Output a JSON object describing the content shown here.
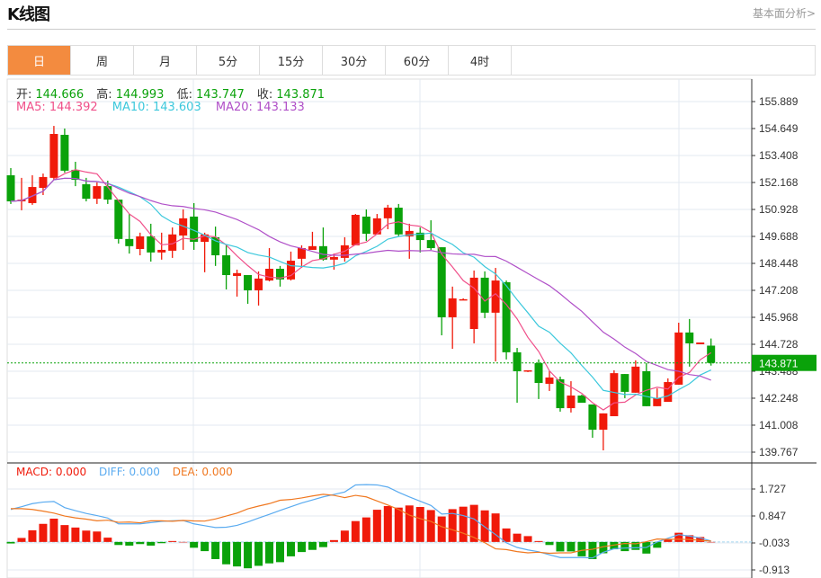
{
  "header": {
    "title": "K线图",
    "link": "基本面分析>"
  },
  "tabs": [
    "日",
    "周",
    "月",
    "5分",
    "15分",
    "30分",
    "60分",
    "4时"
  ],
  "active_tab": 0,
  "ohlc_info": {
    "open_label": "开:",
    "open": "144.666",
    "high_label": "高:",
    "high": "144.993",
    "low_label": "低:",
    "low": "143.747",
    "close_label": "收:",
    "close": "143.871"
  },
  "ma_info": {
    "ma5": "MA5: 144.392",
    "ma10": "MA10: 143.603",
    "ma20": "MA20: 143.133"
  },
  "macd_info": {
    "macd": "MACD: 0.000",
    "diff": "DIFF: 0.000",
    "dea": "DEA: 0.000"
  },
  "current_price": "143.871",
  "colors": {
    "up": "#f01a0a",
    "down": "#0aa20a",
    "ma5": "#f0508a",
    "ma10": "#3cc8dc",
    "ma20": "#b050c8",
    "diff": "#5aabf0",
    "dea": "#f07820"
  },
  "chart_data": {
    "type": "candlestick",
    "price_axis": {
      "ticks": [
        "155.889",
        "154.649",
        "153.408",
        "152.168",
        "150.928",
        "149.688",
        "148.448",
        "147.208",
        "145.968",
        "144.728",
        "143.488",
        "142.248",
        "141.008",
        "139.767"
      ],
      "range": [
        139.767,
        155.889
      ]
    },
    "macd_axis": {
      "ticks": [
        "1.727",
        "0.847",
        "-0.033",
        "-0.913"
      ],
      "range": [
        -0.913,
        1.727
      ]
    },
    "ohlc": [
      [
        152.5,
        152.83,
        151.18,
        151.3
      ],
      [
        151.3,
        152.38,
        150.89,
        151.38
      ],
      [
        151.22,
        152.5,
        151.14,
        151.96
      ],
      [
        151.92,
        152.58,
        151.59,
        152.42
      ],
      [
        152.38,
        154.77,
        152.29,
        154.4
      ],
      [
        154.36,
        154.65,
        152.62,
        152.71
      ],
      [
        152.75,
        153.12,
        152.0,
        152.29
      ],
      [
        152.09,
        152.38,
        151.3,
        151.42
      ],
      [
        151.42,
        152.17,
        151.18,
        152.0
      ],
      [
        152.0,
        152.25,
        151.18,
        151.38
      ],
      [
        151.38,
        151.38,
        149.36,
        149.57
      ],
      [
        149.57,
        150.72,
        148.9,
        149.24
      ],
      [
        149.11,
        149.86,
        148.82,
        149.69
      ],
      [
        149.69,
        150.27,
        148.53,
        148.95
      ],
      [
        148.95,
        149.86,
        148.62,
        149.07
      ],
      [
        149.03,
        150.1,
        148.7,
        149.78
      ],
      [
        149.73,
        150.93,
        149.07,
        150.52
      ],
      [
        150.6,
        151.22,
        149.07,
        149.44
      ],
      [
        149.44,
        149.86,
        148.04,
        149.78
      ],
      [
        149.65,
        150.14,
        148.33,
        148.82
      ],
      [
        148.82,
        149.28,
        147.25,
        147.91
      ],
      [
        147.87,
        148.16,
        146.92,
        148.0
      ],
      [
        147.91,
        147.91,
        146.59,
        147.21
      ],
      [
        147.21,
        148.08,
        146.51,
        147.75
      ],
      [
        147.66,
        149.15,
        147.62,
        148.2
      ],
      [
        148.2,
        148.33,
        147.38,
        147.71
      ],
      [
        147.71,
        148.99,
        147.66,
        148.57
      ],
      [
        148.66,
        149.28,
        148.24,
        149.15
      ],
      [
        149.07,
        149.9,
        149.07,
        149.24
      ],
      [
        149.24,
        150.1,
        148.57,
        148.62
      ],
      [
        148.62,
        148.9,
        148.16,
        148.74
      ],
      [
        148.7,
        149.65,
        148.53,
        149.28
      ],
      [
        149.28,
        150.72,
        149.28,
        150.68
      ],
      [
        150.6,
        150.93,
        149.48,
        149.81
      ],
      [
        149.78,
        150.72,
        149.78,
        150.52
      ],
      [
        150.52,
        151.14,
        150.02,
        151.01
      ],
      [
        151.01,
        151.18,
        149.69,
        149.78
      ],
      [
        149.69,
        150.27,
        148.66,
        149.94
      ],
      [
        149.86,
        150.1,
        148.95,
        149.52
      ],
      [
        149.52,
        150.43,
        149.07,
        149.15
      ],
      [
        149.19,
        149.19,
        145.14,
        145.97
      ],
      [
        145.97,
        147.38,
        144.52,
        146.84
      ],
      [
        146.8,
        146.84,
        146.76,
        146.8
      ],
      [
        145.43,
        148.12,
        144.77,
        147.79
      ],
      [
        147.79,
        148.08,
        145.93,
        146.18
      ],
      [
        146.18,
        148.24,
        143.94,
        147.66
      ],
      [
        147.58,
        147.66,
        144.03,
        144.36
      ],
      [
        144.36,
        144.56,
        142.04,
        143.49
      ],
      [
        143.49,
        143.53,
        143.45,
        143.53
      ],
      [
        143.86,
        144.03,
        142.21,
        142.95
      ],
      [
        142.91,
        143.49,
        142.58,
        143.2
      ],
      [
        143.12,
        143.24,
        141.63,
        141.79
      ],
      [
        141.79,
        143.03,
        141.59,
        142.37
      ],
      [
        142.37,
        142.41,
        142.04,
        142.04
      ],
      [
        141.96,
        141.96,
        140.43,
        140.8
      ],
      [
        140.8,
        141.55,
        139.85,
        141.55
      ],
      [
        141.42,
        143.53,
        141.42,
        143.4
      ],
      [
        143.36,
        143.36,
        142.25,
        142.54
      ],
      [
        142.5,
        143.99,
        142.5,
        143.7
      ],
      [
        143.49,
        143.86,
        141.88,
        141.88
      ],
      [
        141.88,
        142.7,
        141.88,
        142.25
      ],
      [
        142.08,
        143.16,
        142.08,
        142.99
      ],
      [
        142.87,
        145.72,
        142.87,
        145.27
      ],
      [
        145.27,
        145.89,
        143.7,
        144.77
      ],
      [
        144.73,
        144.81,
        144.73,
        144.81
      ],
      [
        144.666,
        144.993,
        143.747,
        143.871
      ]
    ],
    "macd_hist": [
      -0.05,
      0.13,
      0.38,
      0.59,
      0.76,
      0.55,
      0.47,
      0.37,
      0.34,
      0.14,
      -0.1,
      -0.12,
      -0.07,
      -0.12,
      -0.04,
      0.03,
      0.0,
      -0.19,
      -0.3,
      -0.56,
      -0.73,
      -0.8,
      -0.86,
      -0.78,
      -0.7,
      -0.66,
      -0.47,
      -0.33,
      -0.26,
      -0.17,
      0.06,
      0.37,
      0.68,
      0.8,
      1.05,
      1.17,
      1.12,
      1.19,
      1.14,
      1.04,
      0.83,
      1.07,
      1.15,
      1.21,
      1.03,
      0.93,
      0.44,
      0.27,
      0.19,
      0.03,
      -0.1,
      -0.31,
      -0.31,
      -0.47,
      -0.56,
      -0.37,
      -0.24,
      -0.3,
      -0.26,
      -0.38,
      -0.19,
      0.07,
      0.3,
      0.22,
      0.16,
      0.0
    ],
    "diff": [
      1.06,
      1.15,
      1.25,
      1.3,
      1.32,
      1.12,
      1.02,
      0.93,
      0.86,
      0.78,
      0.59,
      0.59,
      0.59,
      0.63,
      0.67,
      0.69,
      0.7,
      0.59,
      0.53,
      0.47,
      0.48,
      0.54,
      0.65,
      0.78,
      0.9,
      1.03,
      1.15,
      1.27,
      1.37,
      1.47,
      1.55,
      1.63,
      1.86,
      1.87,
      1.86,
      1.79,
      1.62,
      1.47,
      1.33,
      1.19,
      0.91,
      0.93,
      0.86,
      0.75,
      0.49,
      0.24,
      -0.03,
      -0.18,
      -0.26,
      -0.32,
      -0.42,
      -0.51,
      -0.51,
      -0.51,
      -0.52,
      -0.34,
      -0.22,
      -0.2,
      -0.19,
      -0.18,
      0.0,
      0.12,
      0.24,
      0.19,
      0.13,
      0.03
    ]
  }
}
